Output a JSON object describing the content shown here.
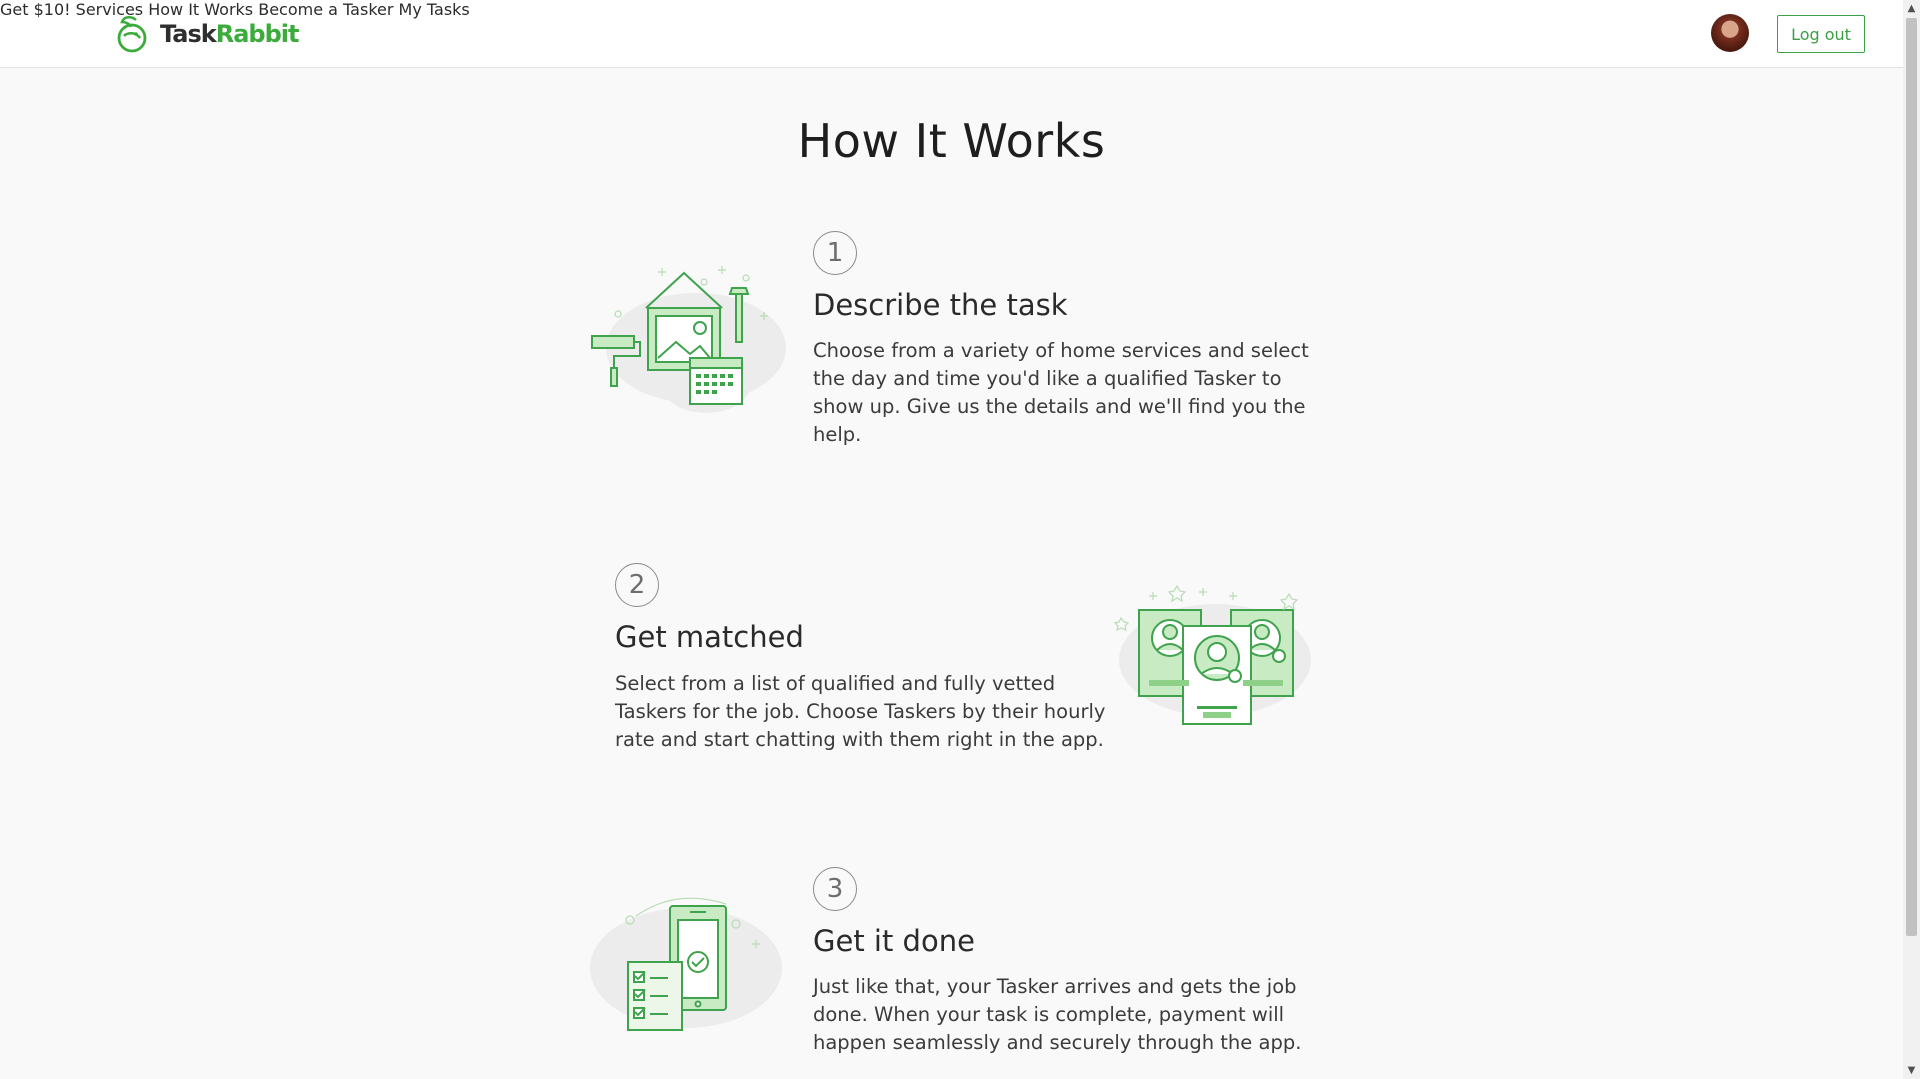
{
  "header": {
    "logo": {
      "part1": "Task",
      "part2": "Rabbit",
      "icon": "rabbit-logo-icon"
    },
    "nav": [
      {
        "label": "Get $10!"
      },
      {
        "label": "Services"
      },
      {
        "label": "How It Works"
      },
      {
        "label": "Become a Tasker"
      },
      {
        "label": "My Tasks"
      }
    ],
    "logout_label": "Log out"
  },
  "page": {
    "title": "How It Works"
  },
  "steps": [
    {
      "number": "1",
      "title": "Describe the task",
      "text": "Choose from a variety of home services and select the day and time you'd like a qualified Tasker to show up. Give us the details and we'll find you the help.",
      "icon": "home-tools-calendar-icon"
    },
    {
      "number": "2",
      "title": "Get matched",
      "text": "Select from a list of qualified and fully vetted Taskers for the job. Choose Taskers by their hourly rate and start chatting with them right in the app.",
      "icon": "tasker-profiles-icon"
    },
    {
      "number": "3",
      "title": "Get it done",
      "text": "Just like that, your Tasker arrives and gets the job done. When your task is complete, payment will happen seamlessly and securely through the app.",
      "icon": "phone-checklist-icon"
    }
  ],
  "colors": {
    "brand_green": "#3aa043",
    "illustration_green": "#b7e2b0",
    "illustration_stroke": "#3fa34d"
  }
}
